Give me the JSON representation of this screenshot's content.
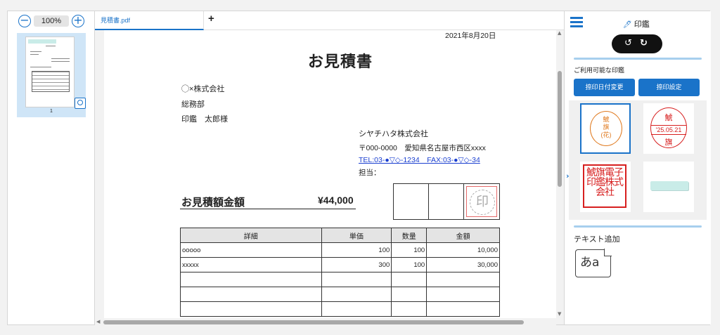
{
  "zoom": {
    "minus": "−",
    "value": "100%",
    "plus": "+"
  },
  "thumbnail": {
    "page_number": "1"
  },
  "tabs": [
    {
      "label": "見積書.pdf"
    }
  ],
  "tab_add": "+",
  "document": {
    "date": "2021年8月20日",
    "title": "お見積書",
    "to_company": "◯×株式会社",
    "to_dept": "総務部",
    "to_person": "印鑑　太郎様",
    "from_company": "シヤチハタ株式会社",
    "from_address": "〒000-0000　愛知県名古屋市西区xxxx",
    "from_tel": "TEL:03-●▽◇-1234　FAX:03-●▽◇-34",
    "from_contact": "担当：",
    "amount_label": "お見積額金額",
    "amount_value": "¥44,000",
    "seal_placeholder": "印",
    "table": {
      "headers": [
        "詳細",
        "単価",
        "数量",
        "金額"
      ],
      "rows": [
        [
          "ooooo",
          "100",
          "100",
          "10,000"
        ],
        [
          "xxxxx",
          "300",
          "100",
          "30,000"
        ],
        [
          "",
          "",
          "",
          ""
        ],
        [
          "",
          "",
          "",
          ""
        ],
        [
          "",
          "",
          "",
          ""
        ]
      ]
    }
  },
  "panel": {
    "title": "印鑑",
    "undo": "↺",
    "redo": "↻",
    "available_label": "ご利用可能な印鑑",
    "btn_date_change": "捺印日付変更",
    "btn_settings": "捺印設定",
    "expander": "›",
    "stamps": {
      "orange": {
        "l1": "鯱",
        "l2": "旗",
        "l3": "(花)"
      },
      "dated": {
        "top": "鯱",
        "date": "'25.05.21",
        "bottom": "旗"
      },
      "square": "鯱旗電子印鑑株式会社"
    },
    "text_add_label": "テキスト追加",
    "text_icon": "あa"
  },
  "colors": {
    "accent": "#1a73c9",
    "stamp_red": "#d71f1f",
    "stamp_orange": "#e07a1f"
  }
}
